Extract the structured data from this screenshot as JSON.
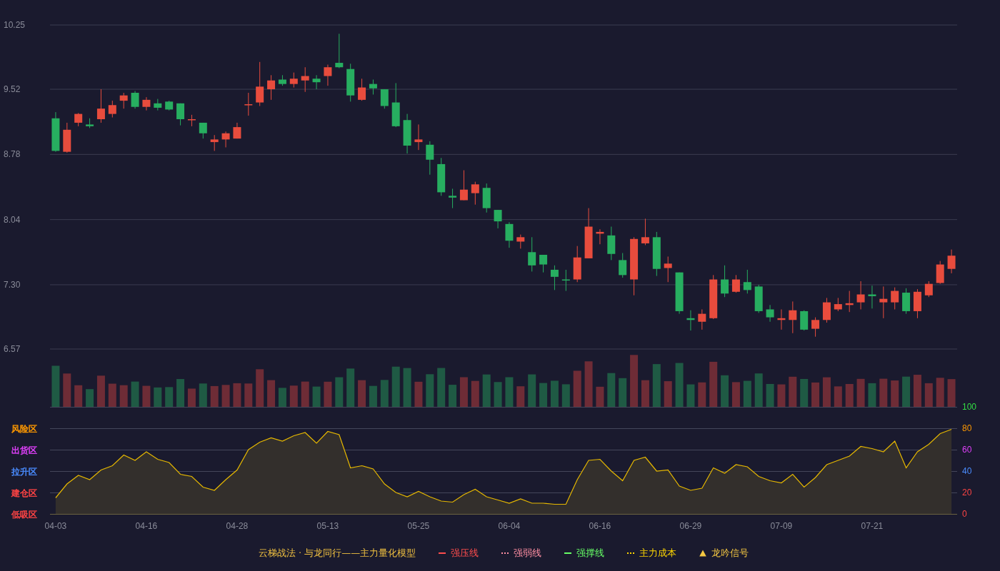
{
  "price_chart": {
    "chart_data": {
      "type": "candlestick",
      "ylim": [
        6.57,
        10.25
      ],
      "grid": true,
      "yticks": [
        {
          "value": 10.25,
          "label": "10.25"
        },
        {
          "value": 9.52,
          "label": "9.52"
        },
        {
          "value": 8.78,
          "label": "8.78"
        },
        {
          "value": 8.04,
          "label": "8.04"
        },
        {
          "value": 7.3,
          "label": "7.30"
        },
        {
          "value": 6.57,
          "label": "6.57"
        }
      ],
      "ohlc": [
        [
          9.19,
          9.26,
          8.81,
          8.82
        ],
        [
          8.81,
          9.14,
          8.8,
          9.06
        ],
        [
          9.14,
          9.25,
          9.1,
          9.24
        ],
        [
          9.12,
          9.19,
          9.08,
          9.1
        ],
        [
          9.18,
          9.52,
          9.14,
          9.3
        ],
        [
          9.24,
          9.39,
          9.2,
          9.34
        ],
        [
          9.39,
          9.48,
          9.3,
          9.45
        ],
        [
          9.48,
          9.5,
          9.3,
          9.32
        ],
        [
          9.32,
          9.43,
          9.28,
          9.4
        ],
        [
          9.36,
          9.41,
          9.28,
          9.31
        ],
        [
          9.38,
          9.39,
          9.28,
          9.29
        ],
        [
          9.36,
          9.36,
          9.11,
          9.18
        ],
        [
          9.17,
          9.23,
          9.1,
          9.18
        ],
        [
          9.14,
          9.14,
          8.96,
          9.02
        ],
        [
          8.92,
          9.0,
          8.82,
          8.95
        ],
        [
          8.95,
          9.04,
          8.86,
          9.02
        ],
        [
          8.96,
          9.14,
          8.96,
          9.09
        ],
        [
          9.34,
          9.48,
          9.22,
          9.35
        ],
        [
          9.37,
          9.83,
          9.33,
          9.55
        ],
        [
          9.52,
          9.68,
          9.4,
          9.62
        ],
        [
          9.63,
          9.68,
          9.56,
          9.58
        ],
        [
          9.58,
          9.71,
          9.54,
          9.64
        ],
        [
          9.62,
          9.77,
          9.49,
          9.67
        ],
        [
          9.64,
          9.68,
          9.52,
          9.6
        ],
        [
          9.67,
          9.8,
          9.56,
          9.77
        ],
        [
          9.82,
          10.15,
          9.76,
          9.77
        ],
        [
          9.75,
          9.81,
          9.38,
          9.45
        ],
        [
          9.4,
          9.64,
          9.39,
          9.54
        ],
        [
          9.58,
          9.63,
          9.46,
          9.53
        ],
        [
          9.52,
          9.52,
          9.3,
          9.33
        ],
        [
          9.37,
          9.59,
          9.09,
          9.1
        ],
        [
          9.17,
          9.24,
          8.79,
          8.88
        ],
        [
          8.92,
          9.12,
          8.83,
          8.95
        ],
        [
          8.89,
          8.93,
          8.55,
          8.72
        ],
        [
          8.67,
          8.74,
          8.31,
          8.35
        ],
        [
          8.31,
          8.39,
          8.17,
          8.29
        ],
        [
          8.26,
          8.6,
          8.26,
          8.38
        ],
        [
          8.34,
          8.47,
          8.21,
          8.44
        ],
        [
          8.4,
          8.45,
          8.12,
          8.17
        ],
        [
          8.15,
          8.15,
          7.94,
          8.02
        ],
        [
          7.99,
          8.01,
          7.72,
          7.8
        ],
        [
          7.79,
          7.87,
          7.71,
          7.84
        ],
        [
          7.67,
          7.84,
          7.45,
          7.52
        ],
        [
          7.64,
          7.64,
          7.44,
          7.53
        ],
        [
          7.47,
          7.52,
          7.24,
          7.39
        ],
        [
          7.36,
          7.47,
          7.23,
          7.35
        ],
        [
          7.36,
          7.74,
          7.33,
          7.61
        ],
        [
          7.6,
          8.17,
          7.6,
          7.96
        ],
        [
          7.88,
          7.93,
          7.76,
          7.9
        ],
        [
          7.86,
          7.96,
          7.58,
          7.65
        ],
        [
          7.58,
          7.66,
          7.38,
          7.41
        ],
        [
          7.36,
          7.84,
          7.18,
          7.82
        ],
        [
          7.77,
          8.05,
          7.75,
          7.84
        ],
        [
          7.84,
          7.9,
          7.4,
          7.48
        ],
        [
          7.49,
          7.62,
          7.33,
          7.54
        ],
        [
          7.44,
          7.44,
          6.97,
          7.0
        ],
        [
          6.92,
          7.01,
          6.78,
          6.9
        ],
        [
          6.88,
          7.02,
          6.79,
          6.97
        ],
        [
          6.92,
          7.41,
          6.91,
          7.36
        ],
        [
          7.36,
          7.52,
          7.16,
          7.2
        ],
        [
          7.22,
          7.41,
          7.21,
          7.36
        ],
        [
          7.33,
          7.47,
          7.2,
          7.24
        ],
        [
          7.28,
          7.3,
          6.98,
          7.0
        ],
        [
          7.02,
          7.07,
          6.88,
          6.93
        ],
        [
          6.9,
          7.02,
          6.79,
          6.92
        ],
        [
          6.9,
          7.11,
          6.75,
          7.01
        ],
        [
          7.0,
          7.01,
          6.78,
          6.79
        ],
        [
          6.8,
          6.93,
          6.71,
          6.9
        ],
        [
          6.9,
          7.15,
          6.87,
          7.1
        ],
        [
          7.02,
          7.15,
          7.0,
          7.08
        ],
        [
          7.07,
          7.23,
          6.99,
          7.09
        ],
        [
          7.1,
          7.34,
          7.02,
          7.19
        ],
        [
          7.19,
          7.29,
          7.03,
          7.17
        ],
        [
          7.1,
          7.28,
          6.92,
          7.14
        ],
        [
          7.1,
          7.27,
          7.02,
          7.23
        ],
        [
          7.21,
          7.26,
          6.97,
          7.0
        ],
        [
          7.0,
          7.25,
          6.92,
          7.22
        ],
        [
          7.18,
          7.34,
          7.16,
          7.31
        ],
        [
          7.32,
          7.57,
          7.31,
          7.53
        ],
        [
          7.48,
          7.7,
          7.43,
          7.63
        ]
      ]
    }
  },
  "indicator_chart": {
    "chart_data": {
      "type": "area",
      "ylim": [
        0,
        100
      ],
      "grid": true,
      "categories": [
        "04-03",
        null,
        null,
        null,
        null,
        null,
        null,
        null,
        "04-16",
        null,
        null,
        null,
        null,
        null,
        null,
        null,
        "04-28",
        null,
        null,
        null,
        null,
        null,
        null,
        null,
        "05-13",
        null,
        null,
        null,
        null,
        null,
        null,
        null,
        "05-25",
        null,
        null,
        null,
        null,
        null,
        null,
        null,
        "06-04",
        null,
        null,
        null,
        null,
        null,
        null,
        null,
        "06-16",
        null,
        null,
        null,
        null,
        null,
        null,
        null,
        "06-29",
        null,
        null,
        null,
        null,
        null,
        null,
        null,
        "07-09",
        null,
        null,
        null,
        null,
        null,
        null,
        null,
        "07-21",
        null,
        null,
        null,
        null,
        null,
        null,
        null
      ],
      "yticks": [
        {
          "value": 100,
          "label": "100"
        },
        {
          "value": 80,
          "label": "80"
        },
        {
          "value": 60,
          "label": "60"
        },
        {
          "value": 40,
          "label": "40"
        },
        {
          "value": 20,
          "label": "20"
        },
        {
          "value": 0,
          "label": "0"
        }
      ],
      "series": [
        {
          "color": "#e6b800",
          "values": [
            15,
            28,
            36,
            32,
            41,
            45,
            55,
            50,
            58,
            51,
            48,
            37,
            35,
            25,
            22,
            32,
            41,
            60,
            67,
            71,
            68,
            73,
            76,
            66,
            77,
            74,
            43,
            45,
            42,
            28,
            20,
            16,
            21,
            16,
            12,
            11,
            18,
            23,
            16,
            13,
            10,
            14,
            10,
            10,
            9,
            9,
            32,
            50,
            51,
            40,
            31,
            50,
            53,
            40,
            41,
            26,
            22,
            24,
            43,
            38,
            46,
            44,
            35,
            31,
            29,
            37,
            25,
            34,
            46,
            50,
            54,
            63,
            61,
            58,
            68,
            43,
            58,
            65,
            75,
            79
          ]
        }
      ]
    },
    "zones": [
      {
        "label": "风险区",
        "color": "#ff9900"
      },
      {
        "label": "出货区",
        "color": "#e040fb"
      },
      {
        "label": "拉升区",
        "color": "#4a8cff"
      },
      {
        "label": "建仓区",
        "color": "#ff4444"
      },
      {
        "label": "低吸区",
        "color": "#ff4444"
      }
    ]
  },
  "legend": {
    "title": "云梯战法 · 与龙同行——主力量化模型",
    "items": [
      {
        "label": "强压线",
        "kind": "solid",
        "color": "#ff4d4d"
      },
      {
        "label": "强弱线",
        "kind": "dashed",
        "color": "#ff8fa3"
      },
      {
        "label": "强撑线",
        "kind": "solid",
        "color": "#66ff66"
      },
      {
        "label": "主力成本",
        "kind": "dashed",
        "color": "#ffd700"
      },
      {
        "label": "龙吟信号",
        "kind": "triangle",
        "color": "#f5c842"
      }
    ]
  }
}
